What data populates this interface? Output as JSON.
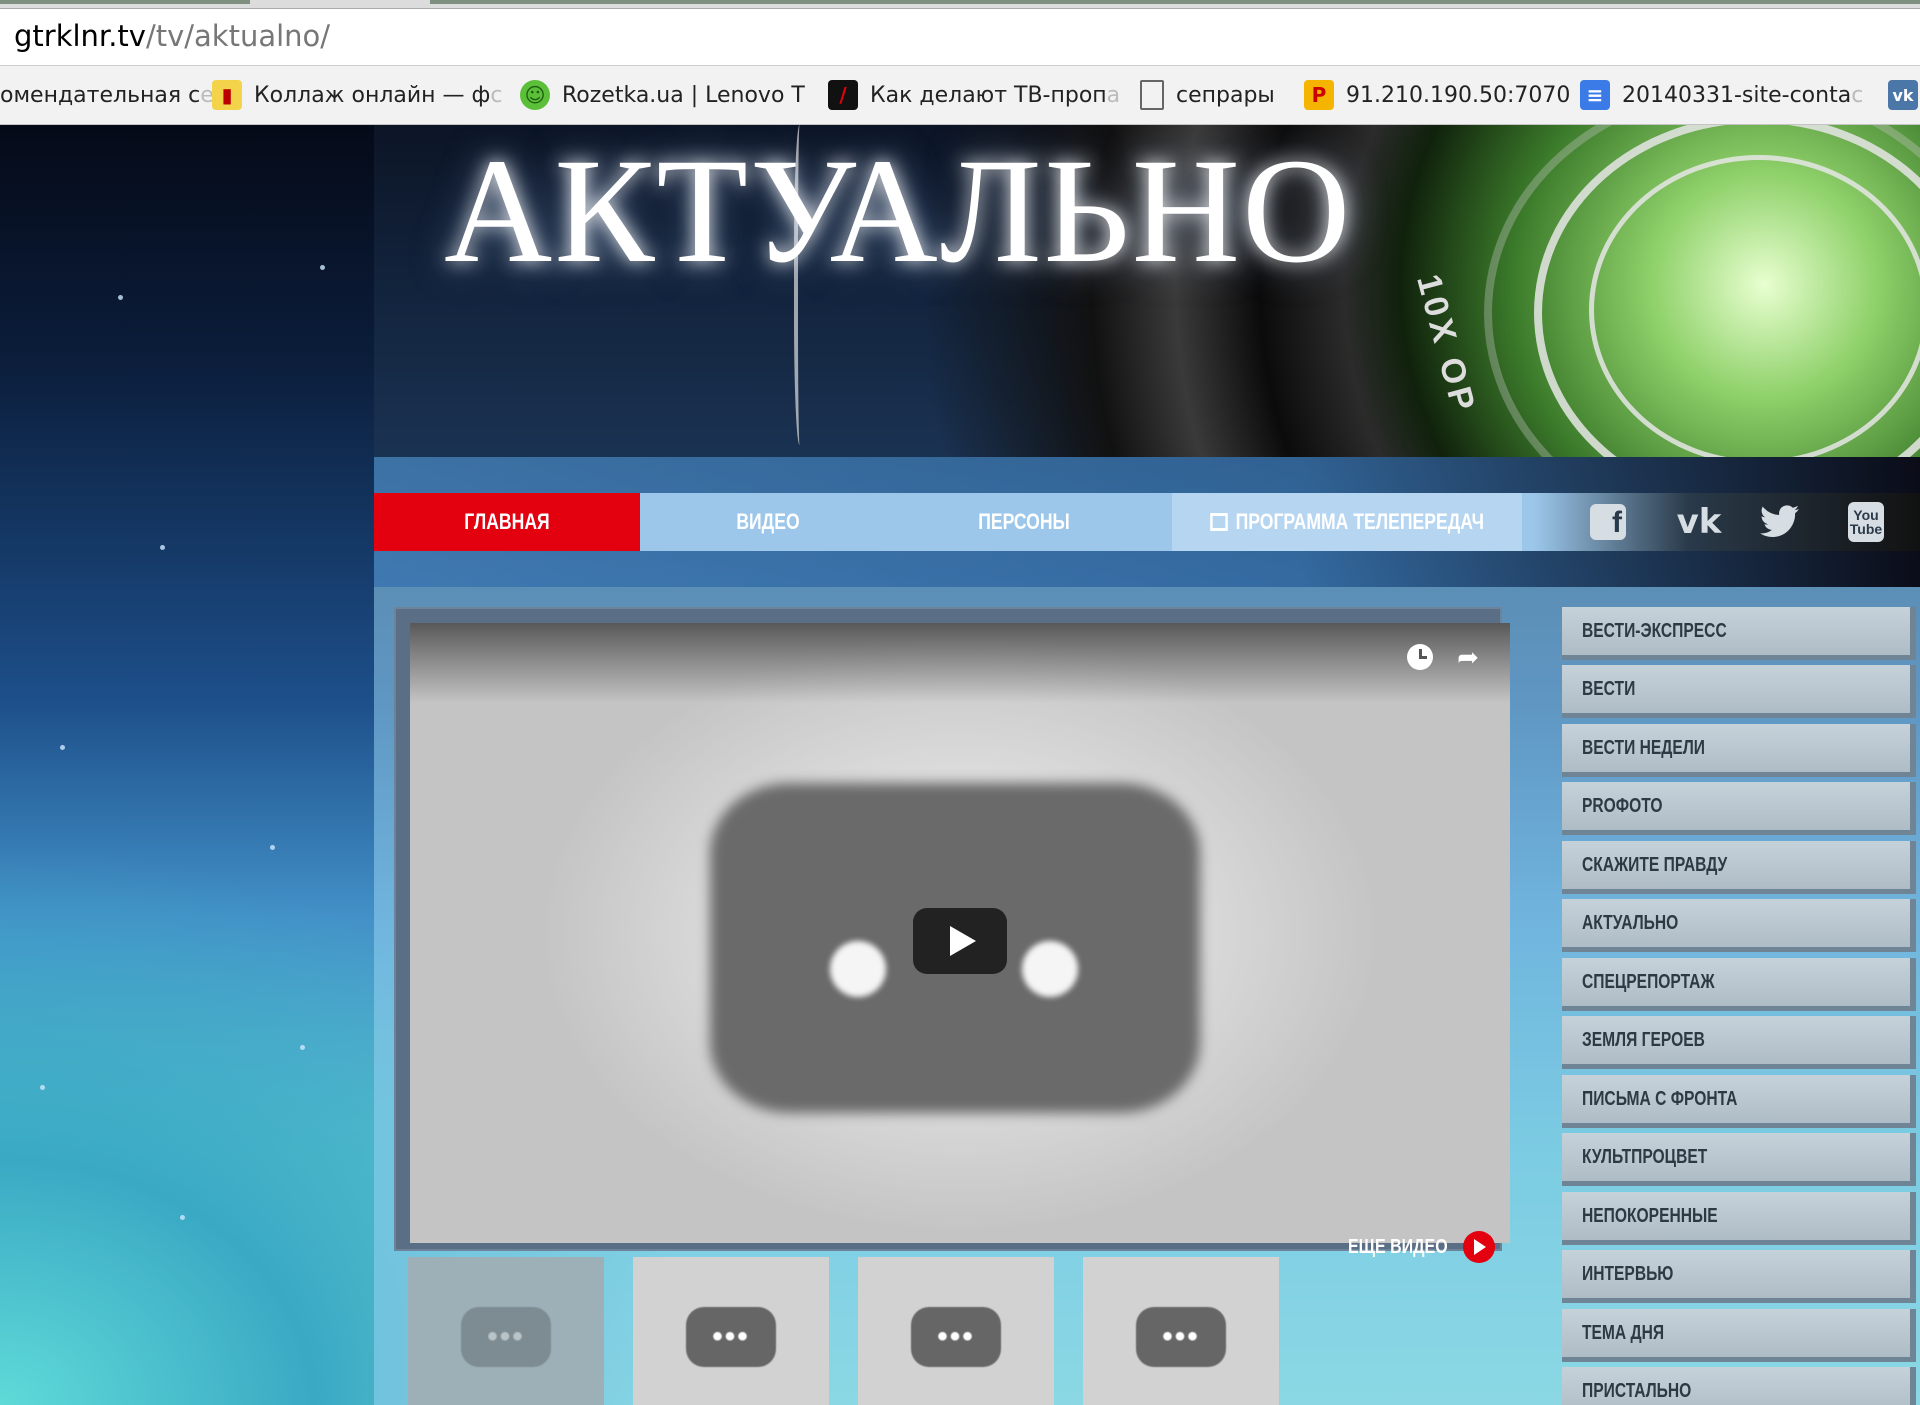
{
  "browser": {
    "url_host": "gtrklnr.tv",
    "url_path": "/tv/aktualno/",
    "bookmarks": [
      {
        "icon": "",
        "label": "омендательная с",
        "fade": "е"
      },
      {
        "icon": "collage-icon",
        "label": "Коллаж онлайн — ф",
        "fade": "с"
      },
      {
        "icon": "frog-icon",
        "label": "Rozetka.ua | Lenovo T",
        "fade": ""
      },
      {
        "icon": "slash-icon",
        "label": "Как делают ТВ-проп",
        "fade": "а"
      },
      {
        "icon": "page-icon",
        "label": "сепрары",
        "fade": ""
      },
      {
        "icon": "p-logo-icon",
        "label": "91.210.190.50:7070",
        "fade": ""
      },
      {
        "icon": "doc-icon",
        "label": "20140331-site-conta",
        "fade": "c"
      },
      {
        "icon": "vk-icon",
        "label": "",
        "fade": ""
      }
    ]
  },
  "banner": {
    "title": "АКТУАЛЬНО",
    "lens_text": "10X OP"
  },
  "nav": {
    "items": [
      "ГЛАВНАЯ",
      "ВИДЕО",
      "ПЕРСОНЫ",
      "ПРОГРАММА ТЕЛЕПЕРЕДАЧ"
    ],
    "social": [
      "facebook-icon",
      "vk-icon",
      "twitter-icon",
      "youtube-icon"
    ],
    "youtube_text": "You Tube"
  },
  "player": {
    "dots": "•••"
  },
  "more_video": "ЕЩЕ ВИДЕО",
  "sidebar": {
    "items": [
      "ВЕСТИ-ЭКСПРЕСС",
      "ВЕСТИ",
      "ВЕСТИ НЕДЕЛИ",
      "PROФОТО",
      "СКАЖИТЕ ПРАВДУ",
      "АКТУАЛЬНО",
      "СПЕЦРЕПОРТАЖ",
      "ЗЕМЛЯ ГЕРОЕВ",
      "ПИСЬМА С ФРОНТА",
      "КУЛЬТПРОЦВЕТ",
      "НЕПОКОРЕННЫЕ",
      "ИНТЕРВЬЮ",
      "ТЕМА ДНЯ",
      "ПРИСТАЛЬНО"
    ]
  },
  "colors": {
    "accent_red": "#e3000f",
    "nav_blue": "#9cc7ea"
  }
}
